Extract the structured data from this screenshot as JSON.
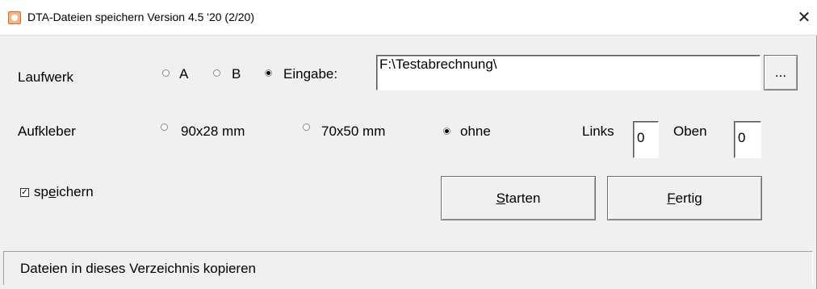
{
  "window": {
    "title": "DTA-Dateien speichern Version 4.5 '20 (2/20)",
    "close_glyph": "✕"
  },
  "drive": {
    "label": "Laufwerk",
    "options": [
      {
        "label": "A",
        "checked": false
      },
      {
        "label": "B",
        "checked": false
      },
      {
        "label": "Eingabe:",
        "checked": true
      }
    ],
    "path_value": "F:\\Testabrechnung\\",
    "browse_label": "..."
  },
  "sticker": {
    "label": "Aufkleber",
    "options": [
      {
        "label": "90x28 mm",
        "checked": false
      },
      {
        "label": "70x50 mm",
        "checked": false
      },
      {
        "label": "ohne",
        "checked": true
      }
    ],
    "links_label": "Links",
    "links_value": "0",
    "oben_label": "Oben",
    "oben_value": "0"
  },
  "save_checkbox": {
    "checked": true,
    "check_glyph": "✓",
    "label_pre": "sp",
    "label_mnemonic": "e",
    "label_post": "ichern"
  },
  "buttons": {
    "start_mnemonic": "S",
    "start_rest": "tarten",
    "done_mnemonic": "F",
    "done_rest": "ertig"
  },
  "status": {
    "text": "Dateien in dieses Verzeichnis kopieren"
  }
}
